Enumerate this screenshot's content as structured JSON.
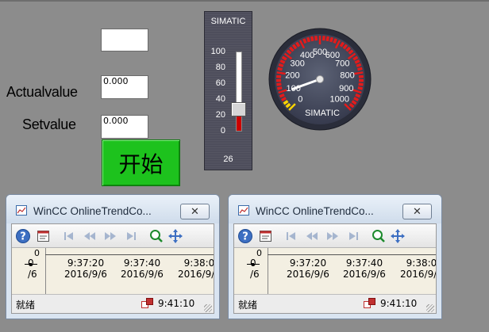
{
  "io_fields": [
    {
      "value": ""
    },
    {
      "value": "0.000"
    },
    {
      "value": "0.000"
    }
  ],
  "labels": {
    "actual": "Actualvalue",
    "set": "Setvalue"
  },
  "start_button": {
    "label": "开始",
    "color": "#1dc21d"
  },
  "slider": {
    "brand": "SIMATIC",
    "ticks": [
      "100",
      "80",
      "60",
      "40",
      "20",
      "0"
    ],
    "value": "26",
    "level_percent": 26,
    "fill_color": "#cc0000"
  },
  "gauge": {
    "brand": "SIMATIC",
    "scale": [
      "0",
      "100",
      "200",
      "300",
      "400",
      "500",
      "600",
      "700",
      "800",
      "900",
      "1000"
    ],
    "needle_value": 0
  },
  "trends": [
    {
      "title": "WinCC OnlineTrendCo...",
      "close": "✕",
      "axis_zero": "0",
      "time_labels": [
        {
          "time": "",
          "date": "0\n/6"
        },
        {
          "time": "9:37:20",
          "date": "2016/9/6"
        },
        {
          "time": "9:37:40",
          "date": "2016/9/6"
        },
        {
          "time": "9:38:0",
          "date": "2016/9/6"
        }
      ],
      "status": "就绪",
      "status_time": "9:41:10"
    },
    {
      "title": "WinCC OnlineTrendCo...",
      "close": "✕",
      "axis_zero": "0",
      "time_labels": [
        {
          "time": "",
          "date": "0\n/6"
        },
        {
          "time": "9:37:20",
          "date": "2016/9/6"
        },
        {
          "time": "9:37:40",
          "date": "2016/9/6"
        },
        {
          "time": "9:38:0",
          "date": "2016/9/6"
        }
      ],
      "status": "就绪",
      "status_time": "9:41:10"
    }
  ]
}
